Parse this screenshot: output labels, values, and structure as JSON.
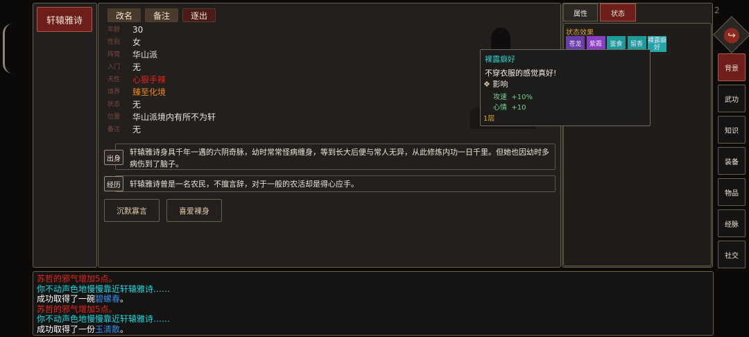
{
  "character": {
    "name": "轩辕雅诗",
    "actions": [
      "改名",
      "备注",
      "逐出"
    ],
    "fields": [
      {
        "label": "年龄",
        "value": "30",
        "color": "#e9e2d6"
      },
      {
        "label": "性别",
        "value": "女",
        "color": "#e9e2d6"
      },
      {
        "label": "阵营",
        "value": "华山派",
        "color": "#e9e2d6"
      },
      {
        "label": "入门",
        "value": "无",
        "color": "#e9e2d6"
      },
      {
        "label": "天性",
        "value": "心狠手辣",
        "color": "#e3241b"
      },
      {
        "label": "境界",
        "value": "臻至化境",
        "color": "#ef8a1a"
      },
      {
        "label": "状态",
        "value": "无",
        "color": "#e9e2d6"
      },
      {
        "label": "位置",
        "value": "华山派境内有所不为轩",
        "color": "#e9e2d6"
      },
      {
        "label": "备注",
        "value": "无",
        "color": "#e9e2d6"
      }
    ],
    "origin": {
      "tag": "出身",
      "text": "轩辕雅诗身具千年一遇的六阴奇脉，幼时常常怪病缠身，等到长大后便与常人无异，从此修炼内功一日千里。但她也因幼时多病伤到了脑子。"
    },
    "experience": {
      "tag": "经历",
      "text": "轩辕雅诗曾是一名农民，不擅言辞，对于一般的农活却是得心应手。"
    },
    "traits": [
      "沉默寡言",
      "喜爱裸身"
    ]
  },
  "right_panel": {
    "tabs": [
      "属性",
      "状态"
    ],
    "section_title": "状态效果",
    "statuses": [
      {
        "text": "苍龙",
        "color": "#6a3ca8"
      },
      {
        "text": "紫霞",
        "color": "#8a3cc4"
      },
      {
        "text": "鉴食",
        "color": "#1f9a9a"
      },
      {
        "text": "留香",
        "color": "#1f9a9a"
      },
      {
        "text": "裸露癖好",
        "color": "#23a6a6"
      }
    ]
  },
  "tooltip": {
    "title": "裸露癖好",
    "desc": "不穿衣服的感觉真好!",
    "effects_header": "影响",
    "effects": [
      {
        "name": "攻速",
        "value": "+10%"
      },
      {
        "name": "心情",
        "value": "+10"
      }
    ],
    "stack": "1层"
  },
  "top_right_number": "2",
  "sidebar": [
    "背景",
    "武功",
    "知识",
    "装备",
    "物品",
    "经脉",
    "社交"
  ],
  "log": [
    [
      {
        "t": "苏哲的邪气增加5点。",
        "c": "#e8261c"
      }
    ],
    [
      {
        "t": "你不动声色地慢慢靠近轩辕雅诗……",
        "c": "#18d8e0"
      }
    ],
    [
      {
        "t": "成功取得了一碗",
        "c": "#ffffff"
      },
      {
        "t": "碧螺春",
        "c": "#2f8be6"
      },
      {
        "t": "。",
        "c": "#ffffff"
      }
    ],
    [
      {
        "t": "苏哲的邪气增加5点。",
        "c": "#e8261c"
      }
    ],
    [
      {
        "t": "你不动声色地慢慢靠近轩辕雅诗……",
        "c": "#18d8e0"
      }
    ],
    [
      {
        "t": "成功取得了一份",
        "c": "#ffffff"
      },
      {
        "t": "玉清散",
        "c": "#2f8be6"
      },
      {
        "t": "。",
        "c": "#ffffff"
      }
    ]
  ]
}
